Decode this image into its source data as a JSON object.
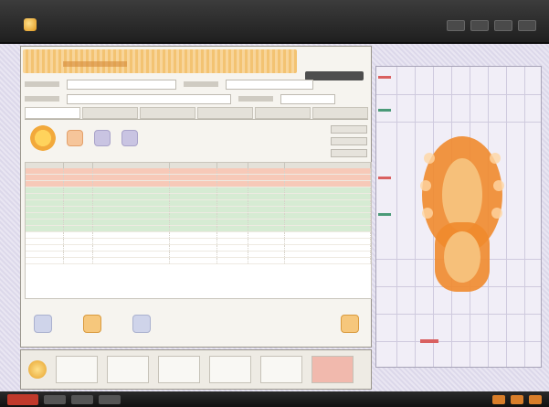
{
  "window": {
    "title": ""
  },
  "header": {
    "title": "",
    "action_label": ""
  },
  "tabs": [
    "",
    "",
    "",
    "",
    "",
    ""
  ],
  "grid": {
    "rows": 15
  },
  "colors": {
    "accent": "#f2a93b",
    "highlight": "#f7c9b8",
    "alt_row": "#d6ebd3",
    "tooth": "#f08a2c"
  }
}
